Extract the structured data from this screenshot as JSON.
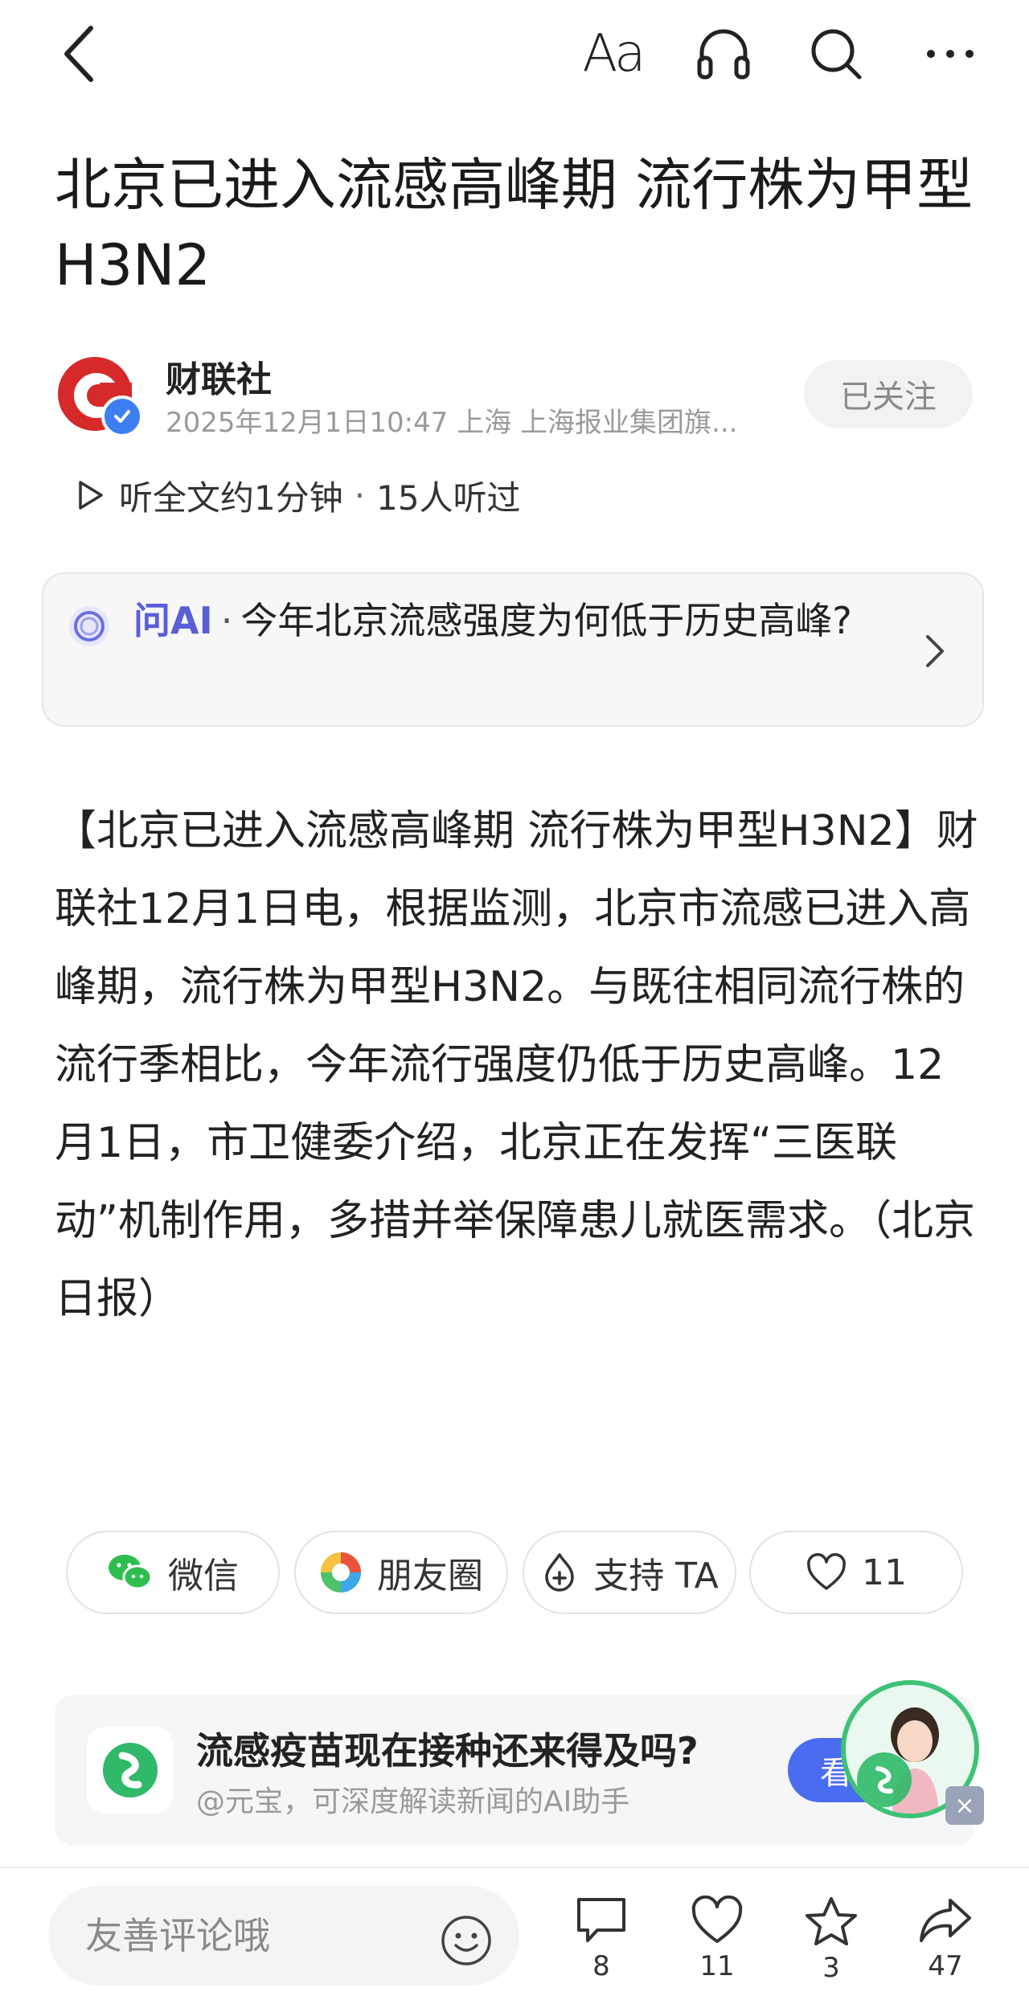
{
  "topbar": {
    "font_label": "Aa"
  },
  "article": {
    "title": "北京已进入流感高峰期 流行株为甲型H3N2",
    "author": "财联社",
    "meta": "2025年12月1日10:47 上海 上海报业集团旗...",
    "follow_label": "已关注",
    "listen_label": "听全文约1分钟",
    "listen_sep": "·",
    "listen_count": "15人听过",
    "body": "【北京已进入流感高峰期 流行株为甲型H3N2】财联社12月1日电，根据监测，北京市流感已进入高峰期，流行株为甲型H3N2。与既往相同流行株的流行季相比，今年流行强度仍低于历史高峰。12月1日，市卫健委介绍，北京正在发挥“三医联动”机制作用，多措并举保障患儿就医需求。（北京日报）"
  },
  "ask_ai": {
    "label": "问AI",
    "sep": "·",
    "question": "今年北京流感强度为何低于历史高峰?"
  },
  "actions": {
    "wechat": "微信",
    "moments": "朋友圈",
    "support": "支持 TA",
    "likes": "11"
  },
  "ad": {
    "title": "流感疫苗现在接种还来得及吗?",
    "subtitle": "@元宝，可深度解读新闻的AI助手",
    "button": "看",
    "close": "×"
  },
  "bottom_bar": {
    "comment_placeholder": "友善评论哦",
    "comments": "8",
    "likes": "11",
    "favorites": "3",
    "shares": "47"
  },
  "colors": {
    "ai_accent": "#5a5fd8",
    "ad_button": "#4a6cf0",
    "verified": "#3d7ef0",
    "brand_red": "#d62a2a"
  },
  "icons": [
    "back-icon",
    "font-size-icon",
    "headphone-icon",
    "search-icon",
    "more-icon",
    "play-icon",
    "ai-icon",
    "chevron-right-icon",
    "wechat-icon",
    "moments-icon",
    "support-icon",
    "heart-icon",
    "emoji-icon",
    "comment-icon",
    "star-icon",
    "share-icon"
  ]
}
